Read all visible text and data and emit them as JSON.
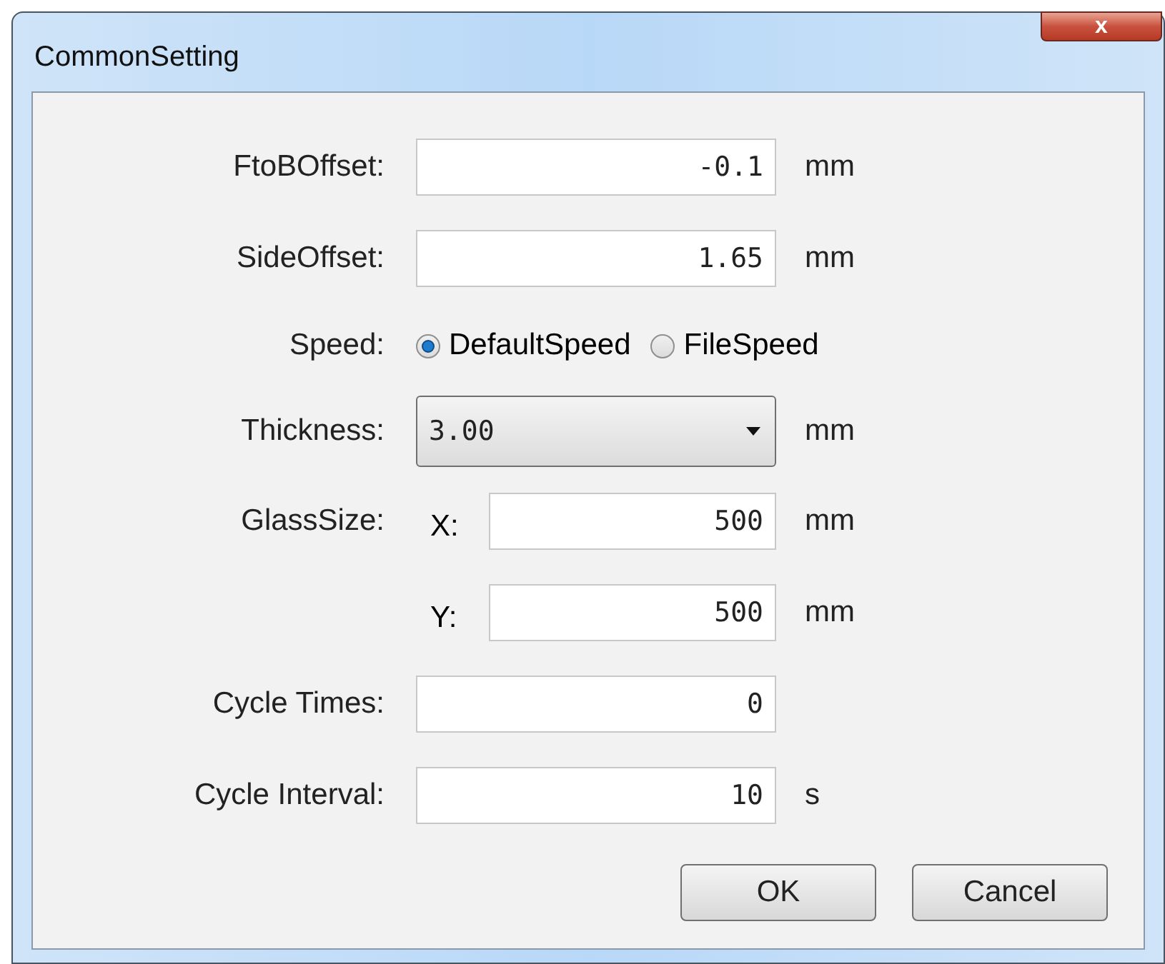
{
  "window": {
    "title": "CommonSetting",
    "close": "x"
  },
  "rows": [
    {
      "kind": "text",
      "label": "FtoBOffset:",
      "value": "-0.1",
      "unit": "mm"
    },
    {
      "kind": "text",
      "label": "SideOffset:",
      "value": "1.65",
      "unit": "mm"
    },
    {
      "kind": "radio",
      "label": "Speed:",
      "options": [
        {
          "label": "DefaultSpeed",
          "selected": true
        },
        {
          "label": "FileSpeed",
          "selected": false
        }
      ]
    },
    {
      "kind": "dropdown",
      "label": "Thickness:",
      "value": "3.00",
      "unit": "mm"
    },
    {
      "kind": "text",
      "label": "GlassSize:",
      "prefix": "X:",
      "value": "500",
      "unit": "mm"
    },
    {
      "kind": "text",
      "prefix": "Y:",
      "value": "500",
      "unit": "mm"
    },
    {
      "kind": "text",
      "label": "Cycle Times:",
      "value": "0"
    },
    {
      "kind": "text",
      "label": "Cycle Interval:",
      "value": "10",
      "unit": "s"
    }
  ],
  "buttons": [
    "OK",
    "Cancel"
  ]
}
